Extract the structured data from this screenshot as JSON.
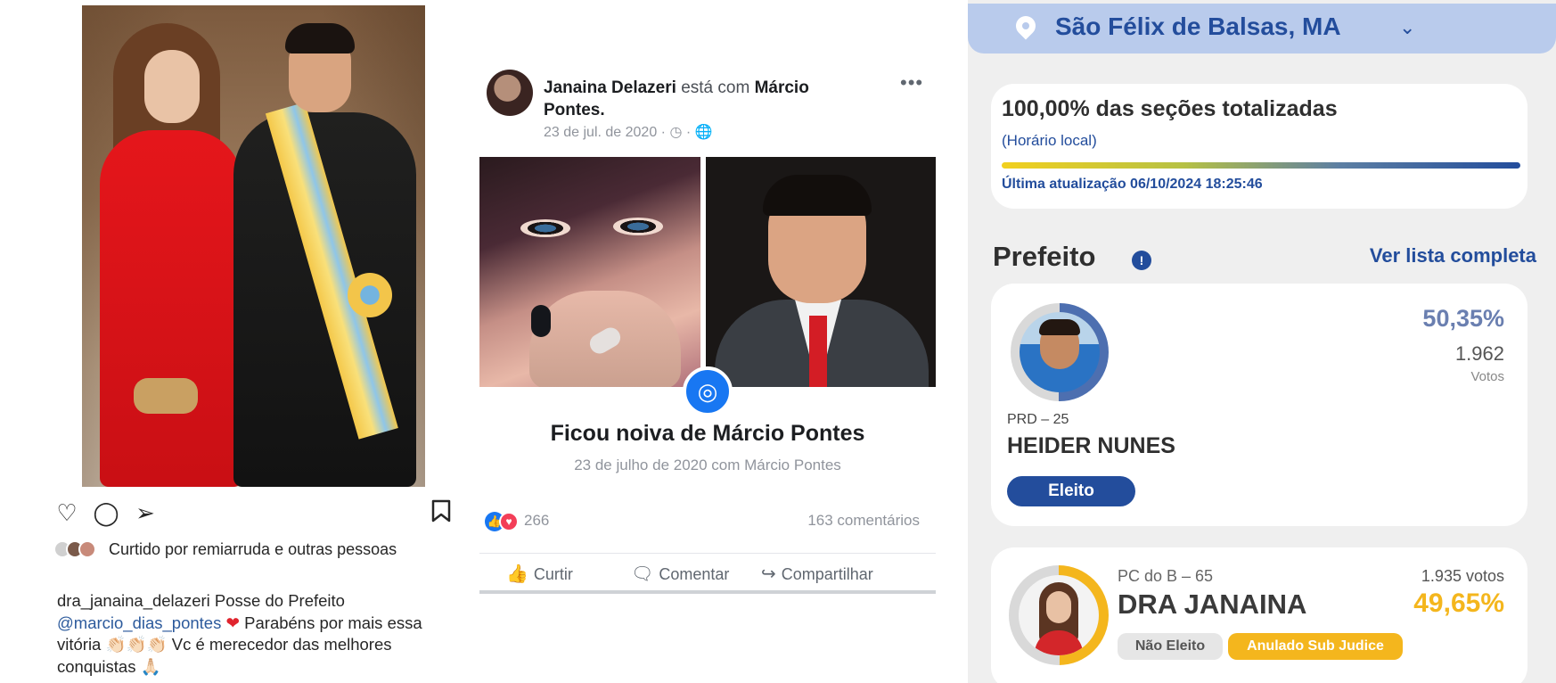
{
  "instagram": {
    "liked_text": "Curtido por remiarruda e outras pessoas",
    "caption_user": "dra_janaina_delazeri",
    "caption_part1": "Posse do Prefeito",
    "mention": "@marcio_dias_pontes",
    "caption_part2": "Parabéns por mais essa vitória 👏🏻👏🏻👏🏻 Vc é merecedor das melhores conquistas 🙏🏻",
    "icons": [
      "heart-icon",
      "comment-icon",
      "share-icon",
      "bookmark-icon"
    ]
  },
  "facebook": {
    "poster_name": "Janaina Delazeri",
    "with_word": "está com",
    "tagged_name": "Márcio Pontes.",
    "date": "23 de jul. de 2020 · ◷ · 🌐",
    "more": "•••",
    "event_title": "Ficou noiva de Márcio Pontes",
    "event_sub": "23 de julho de 2020 com Márcio Pontes",
    "reactions_count": "266",
    "comments_count": "163 comentários",
    "like_label": "Curtir",
    "comment_label": "Comentar",
    "share_label": "Compartilhar"
  },
  "results": {
    "location": "São Félix de Balsas, MA",
    "totals_title": "100,00% das seções totalizadas",
    "timezone_note": "(Horário local)",
    "progress": 1.0,
    "last_update": "Última atualização 06/10/2024 18:25:46",
    "section_title": "Prefeito",
    "info_glyph": "!",
    "see_all": "Ver lista completa",
    "candidates": [
      {
        "party": "PRD – 25",
        "name": "HEIDER NUNES",
        "percent": "50,35%",
        "votes": "1.962",
        "votes_label": "Votos",
        "status": "Eleito",
        "share": 0.5035
      },
      {
        "party": "PC do B – 65",
        "name": "DRA JANAINA",
        "percent": "49,65%",
        "votes": "1.935 votos",
        "status": "Não Eleito",
        "status2": "Anulado Sub Judice",
        "share": 0.4965
      }
    ],
    "colors": {
      "brand_blue": "#234d9c",
      "location_bg": "#b9cbec",
      "winner_ring": "#4d6fb0",
      "runner_up": "#f4b61d"
    }
  }
}
